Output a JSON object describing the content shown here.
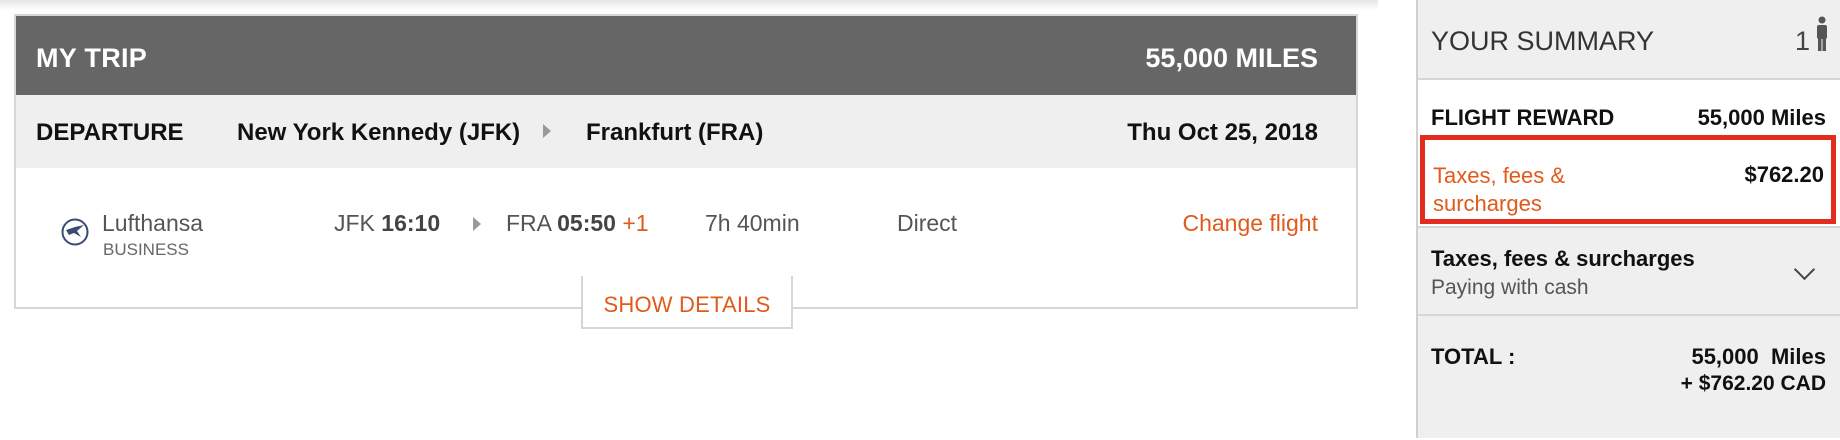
{
  "trip": {
    "title": "MY TRIP",
    "total_miles": "55,000 MILES"
  },
  "departure": {
    "label": "DEPARTURE",
    "origin": "New York Kennedy (JFK)",
    "destination": "Frankfurt (FRA)",
    "date": "Thu Oct 25, 2018"
  },
  "flight": {
    "airline": "Lufthansa",
    "cabin": "BUSINESS",
    "dep_airport": "JFK",
    "dep_time": "16:10",
    "arr_airport": "FRA",
    "arr_time": "05:50",
    "day_offset": "+1",
    "duration": "7h 40min",
    "stops": "Direct",
    "change_label": "Change flight",
    "logo_icon": "lufthansa-crane-icon"
  },
  "show_details_label": "SHOW DETAILS",
  "summary": {
    "title": "YOUR SUMMARY",
    "passengers": "1",
    "reward_label": "FLIGHT REWARD",
    "reward_value": "55,000 Miles",
    "tax_label": "Taxes, fees & surcharges",
    "tax_value": "$762.20",
    "tax_toggle_title": "Taxes, fees & surcharges",
    "tax_toggle_sub": "Paying with cash",
    "total_label": "TOTAL :",
    "total_miles": "55,000  Miles",
    "total_cash": "+ $762.20 CAD"
  },
  "colors": {
    "header_gray": "#666666",
    "accent_orange": "#e05a1a",
    "highlight_red": "#e32b1e"
  }
}
